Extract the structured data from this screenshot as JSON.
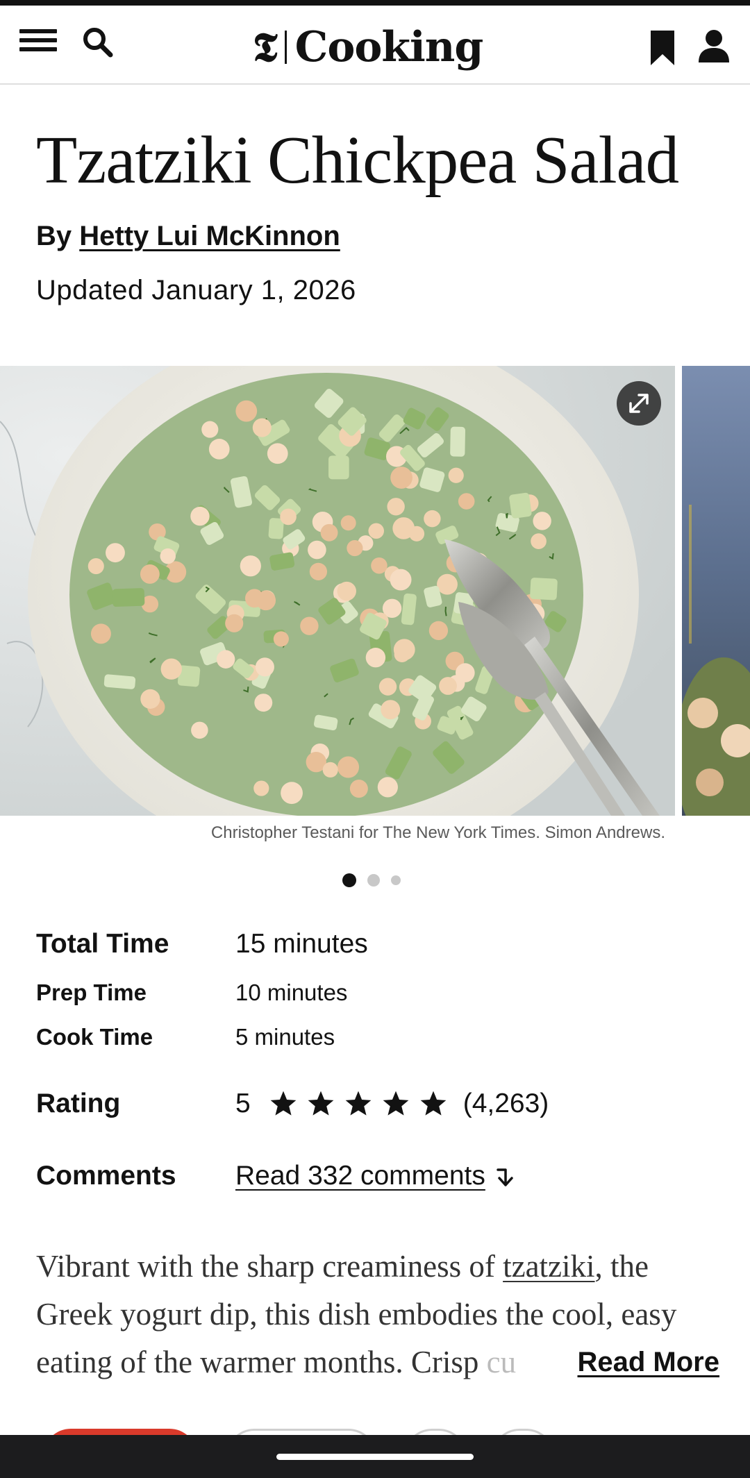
{
  "header": {
    "menu_icon": "hamburger-menu-icon",
    "search_icon": "search-icon",
    "logo_mark": "𝕿",
    "logo_text": "Cooking",
    "bookmark_icon": "bookmark-icon",
    "account_icon": "person-icon"
  },
  "recipe": {
    "title": "Tzatziki Chickpea Salad",
    "byline_prefix": "By",
    "author": "Hetty Lui McKinnon",
    "updated": "Updated January 1, 2026"
  },
  "gallery": {
    "caption": "Christopher Testani for The New York Times. Simon Andrews.",
    "expand_icon": "expand-arrows-icon",
    "slide_count": 3,
    "active_slide": 1
  },
  "details": {
    "total_time_label": "Total Time",
    "total_time_value": "15 minutes",
    "prep_time_label": "Prep Time",
    "prep_time_value": "10 minutes",
    "cook_time_label": "Cook Time",
    "cook_time_value": "5 minutes",
    "rating_label": "Rating",
    "rating_value": "5",
    "rating_stars": 5,
    "rating_count": "(4,263)",
    "comments_label": "Comments",
    "comments_link": "Read 332 comments",
    "comments_icon": "arrow-down-icon"
  },
  "description": {
    "line1_a": "Vibrant with the sharp creaminess of ",
    "line1_link": "tzatziki",
    "line1_b": ", the",
    "line2": "Greek yogurt dip, this dish embodies the cool, easy",
    "line3_a": "eating of the warmer months. Crisp ",
    "line3_fade": "cu",
    "read_more": "Read More"
  },
  "colors": {
    "text": "#121212",
    "accent_red": "#d93a2b",
    "divider": "#dfdfdf",
    "system_bar": "#1c1c1e"
  }
}
